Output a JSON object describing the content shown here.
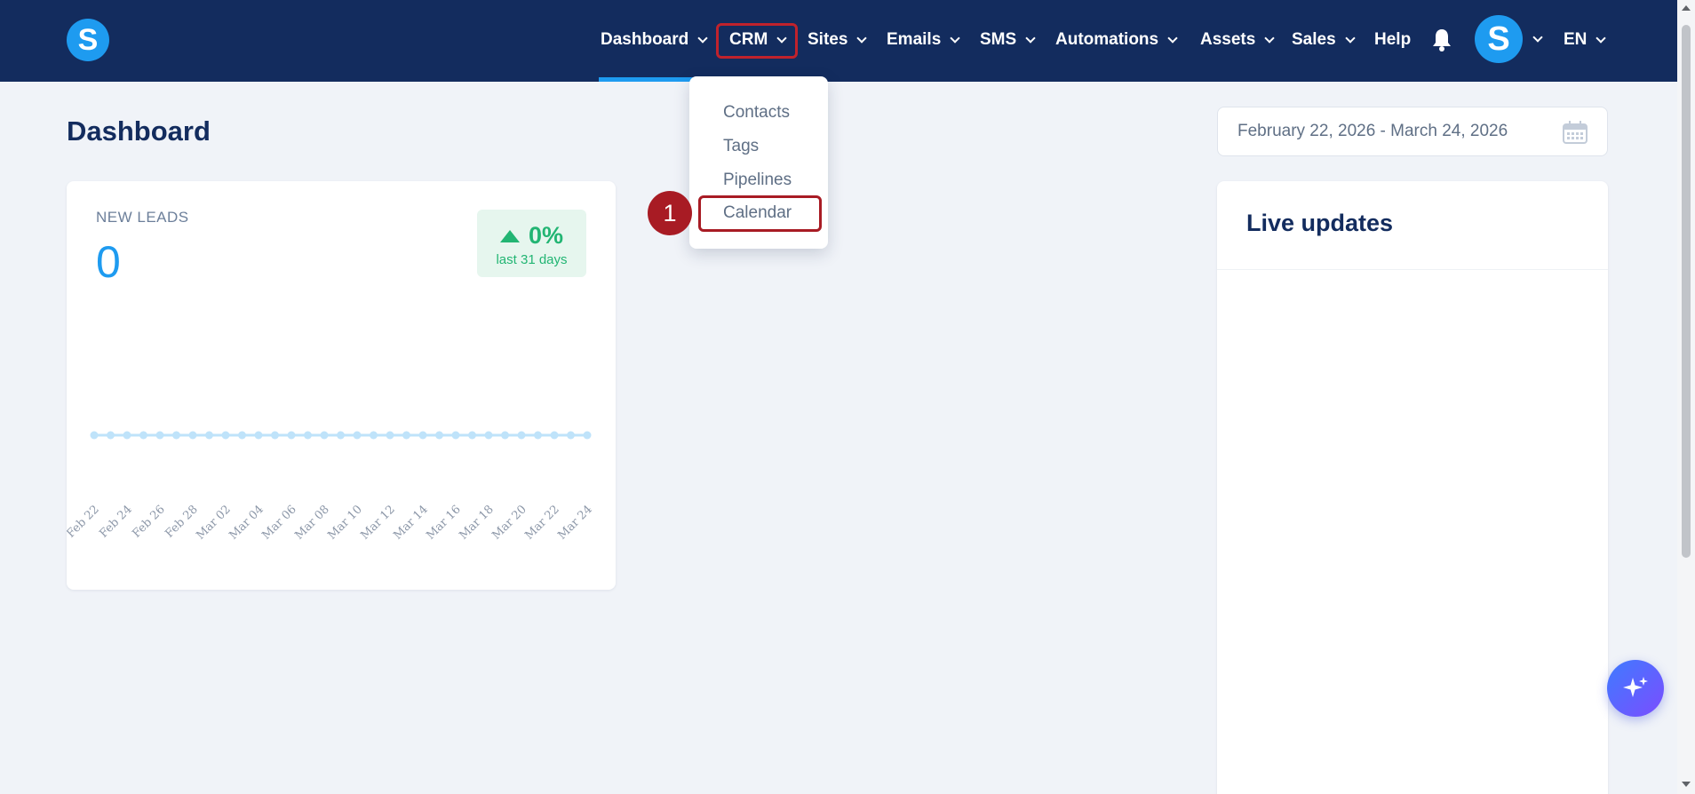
{
  "brand": {
    "logo_letter": "S"
  },
  "nav": {
    "items": [
      {
        "label": "Dashboard",
        "has_dropdown": true,
        "active": true
      },
      {
        "label": "CRM",
        "has_dropdown": true,
        "highlighted": true
      },
      {
        "label": "Sites",
        "has_dropdown": true
      },
      {
        "label": "Emails",
        "has_dropdown": true
      },
      {
        "label": "SMS",
        "has_dropdown": true
      },
      {
        "label": "Automations",
        "has_dropdown": true
      },
      {
        "label": "Assets",
        "has_dropdown": true
      },
      {
        "label": "Sales",
        "has_dropdown": true
      },
      {
        "label": "Help",
        "has_dropdown": false
      }
    ],
    "avatar_letter": "S",
    "language": "EN"
  },
  "crm_menu": {
    "items": [
      "Contacts",
      "Tags",
      "Pipelines",
      "Calendar"
    ],
    "highlighted": "Calendar",
    "step_number": "1"
  },
  "page": {
    "title": "Dashboard",
    "date_range": "February 22, 2026 - March 24, 2026"
  },
  "new_leads": {
    "label": "NEW LEADS",
    "value": "0",
    "trend_value": "0%",
    "trend_period": "last 31 days",
    "trend_direction": "up"
  },
  "chart_data": {
    "type": "line",
    "x": [
      "Feb 22",
      "Feb 23",
      "Feb 24",
      "Feb 25",
      "Feb 26",
      "Feb 27",
      "Feb 28",
      "Mar 01",
      "Mar 02",
      "Mar 03",
      "Mar 04",
      "Mar 05",
      "Mar 06",
      "Mar 07",
      "Mar 08",
      "Mar 09",
      "Mar 10",
      "Mar 11",
      "Mar 12",
      "Mar 13",
      "Mar 14",
      "Mar 15",
      "Mar 16",
      "Mar 17",
      "Mar 18",
      "Mar 19",
      "Mar 20",
      "Mar 21",
      "Mar 22",
      "Mar 23",
      "Mar 24"
    ],
    "tick_labels": [
      "Feb 22",
      "Feb 24",
      "Feb 26",
      "Feb 28",
      "Mar 02",
      "Mar 04",
      "Mar 06",
      "Mar 08",
      "Mar 10",
      "Mar 12",
      "Mar 14",
      "Mar 16",
      "Mar 18",
      "Mar 20",
      "Mar 22",
      "Mar 24"
    ],
    "series": [
      {
        "values": [
          0,
          0,
          0,
          0,
          0,
          0,
          0,
          0,
          0,
          0,
          0,
          0,
          0,
          0,
          0,
          0,
          0,
          0,
          0,
          0,
          0,
          0,
          0,
          0,
          0,
          0,
          0,
          0,
          0,
          0,
          0
        ]
      }
    ],
    "color": "#bfe3fa",
    "grid": false
  },
  "live_updates": {
    "title": "Live updates"
  },
  "colors": {
    "nav_bg": "#132c5e",
    "accent": "#1e9bf0",
    "page_bg": "#f0f3f8",
    "success": "#22b573",
    "highlight": "#a81b24"
  },
  "icons": {
    "bell": "bell-icon",
    "calendar": "calendar-icon",
    "ai": "sparkles-icon"
  }
}
